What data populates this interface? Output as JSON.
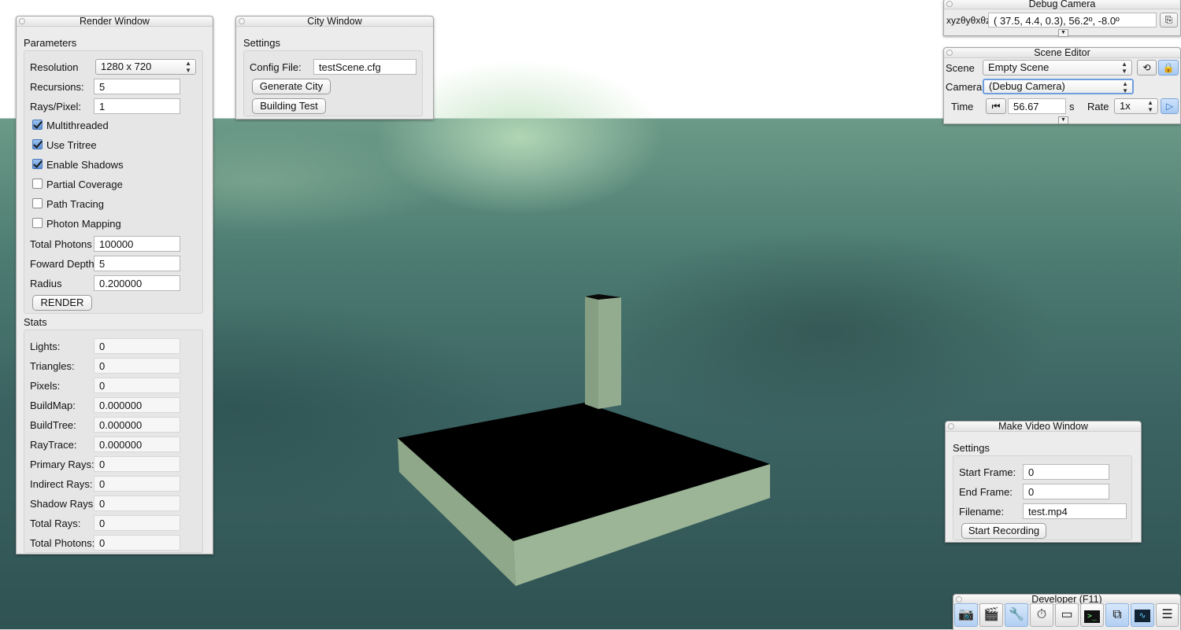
{
  "render_window": {
    "title": "Render Window",
    "parameters_label": "Parameters",
    "resolution_label": "Resolution",
    "resolution_value": "1280 x 720",
    "recursions_label": "Recursions:",
    "recursions_value": "5",
    "rays_label": "Rays/Pixel:",
    "rays_value": "1",
    "checkboxes": [
      {
        "label": "Multithreaded",
        "checked": true
      },
      {
        "label": "Use Tritree",
        "checked": true
      },
      {
        "label": "Enable Shadows",
        "checked": true
      },
      {
        "label": "Partial Coverage",
        "checked": false
      },
      {
        "label": "Path Tracing",
        "checked": false
      },
      {
        "label": "Photon Mapping",
        "checked": false
      }
    ],
    "total_photons_label": "Total Photons",
    "total_photons_value": "100000",
    "forward_depth_label": "Foward Depth",
    "forward_depth_value": "5",
    "radius_label": "Radius",
    "radius_value": "0.200000",
    "render_button": "RENDER",
    "stats_label": "Stats",
    "stats": [
      {
        "label": "Lights:",
        "value": "0"
      },
      {
        "label": "Triangles:",
        "value": "0"
      },
      {
        "label": "Pixels:",
        "value": "0"
      },
      {
        "label": "BuildMap:",
        "value": "0.000000"
      },
      {
        "label": "BuildTree:",
        "value": "0.000000"
      },
      {
        "label": "RayTrace:",
        "value": "0.000000"
      },
      {
        "label": "Primary Rays:",
        "value": "0"
      },
      {
        "label": "Indirect Rays:",
        "value": "0"
      },
      {
        "label": "Shadow Rays:",
        "value": "0"
      },
      {
        "label": "Total Rays:",
        "value": "0"
      },
      {
        "label": "Total Photons:",
        "value": "0"
      }
    ]
  },
  "city_window": {
    "title": "City Window",
    "settings_label": "Settings",
    "config_label": "Config File:",
    "config_value": "testScene.cfg",
    "generate_button": "Generate City",
    "building_button": "Building Test"
  },
  "debug_camera": {
    "title": "Debug Camera",
    "xyz_label": "xyzθyθxθz",
    "value": "( 37.5,   4.4,   0.3),  56.2º,  -8.0º"
  },
  "scene_editor": {
    "title": "Scene Editor",
    "scene_label": "Scene",
    "scene_value": "Empty Scene",
    "camera_label": "Camera",
    "camera_value": "(Debug Camera)",
    "time_label": "Time",
    "time_value": "56.67",
    "time_unit": "s",
    "rate_label": "Rate",
    "rate_value": "1x"
  },
  "make_video": {
    "title": "Make Video Window",
    "settings_label": "Settings",
    "start_frame_label": "Start Frame:",
    "start_frame_value": "0",
    "end_frame_label": "End Frame:",
    "end_frame_value": "0",
    "filename_label": "Filename:",
    "filename_value": "test.mp4",
    "record_button": "Start Recording"
  },
  "developer": {
    "title": "Developer (F11)",
    "tools": [
      {
        "icon": "camera-icon",
        "active": true
      },
      {
        "icon": "clapperboard-icon",
        "active": false
      },
      {
        "icon": "tools-icon",
        "active": true
      },
      {
        "icon": "stopwatch-icon",
        "active": false
      },
      {
        "icon": "new-window-icon",
        "active": false
      },
      {
        "icon": "terminal-icon",
        "active": false
      },
      {
        "icon": "windows-icon",
        "active": true
      },
      {
        "icon": "profiler-icon",
        "active": true
      },
      {
        "icon": "document-icon",
        "active": false
      }
    ]
  },
  "colors": {
    "sky_glow": "#bfe1c0",
    "sky_dark": "#2f5252",
    "platform_side": "#8fa98b",
    "platform_top": "#000000",
    "checkbox_checked": "#5a8fd6",
    "focus_ring": "#6f9fe0"
  }
}
